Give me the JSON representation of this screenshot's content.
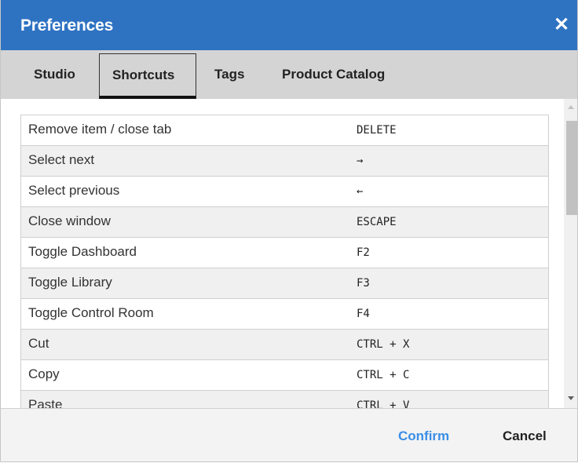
{
  "dialog": {
    "title": "Preferences",
    "close_glyph": "✕"
  },
  "tabs": [
    {
      "label": "Studio",
      "active": false
    },
    {
      "label": "Shortcuts",
      "active": true
    },
    {
      "label": "Tags",
      "active": false
    },
    {
      "label": "Product Catalog",
      "active": false
    }
  ],
  "shortcuts": [
    {
      "action": "Remove item / close tab",
      "key": "DELETE"
    },
    {
      "action": "Select next",
      "key": "→"
    },
    {
      "action": "Select previous",
      "key": "←"
    },
    {
      "action": "Close window",
      "key": "ESCAPE"
    },
    {
      "action": "Toggle Dashboard",
      "key": "F2"
    },
    {
      "action": "Toggle Library",
      "key": "F3"
    },
    {
      "action": "Toggle Control Room",
      "key": "F4"
    },
    {
      "action": "Cut",
      "key": "CTRL + X"
    },
    {
      "action": "Copy",
      "key": "CTRL + C"
    },
    {
      "action": "Paste",
      "key": "CTRL + V"
    }
  ],
  "footer": {
    "confirm_label": "Confirm",
    "cancel_label": "Cancel"
  },
  "colors": {
    "titlebar": "#2e72c2",
    "tabbar": "#d4d4d4",
    "confirm": "#3a8ee6"
  },
  "icons": {
    "close": "close-icon",
    "scroll_up": "arrow-up-icon",
    "scroll_down": "arrow-down-icon"
  }
}
